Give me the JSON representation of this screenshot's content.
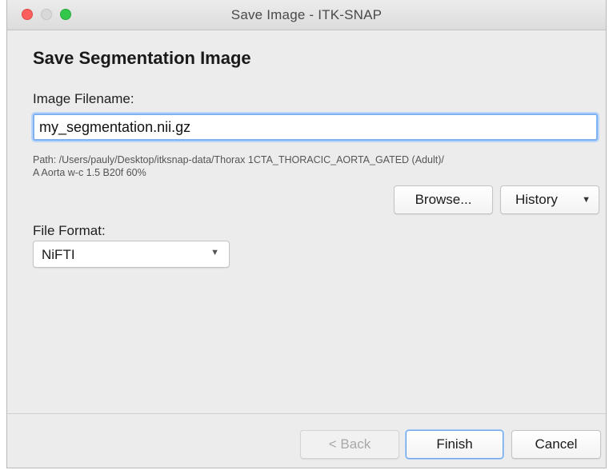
{
  "window": {
    "title": "Save Image - ITK-SNAP"
  },
  "dialog": {
    "heading": "Save Segmentation Image",
    "filename_label": "Image Filename:",
    "filename_value": "my_segmentation.nii.gz",
    "path_line1": "Path: /Users/pauly/Desktop/itksnap-data/Thorax 1CTA_THORACIC_AORTA_GATED (Adult)/",
    "path_line2": "A Aorta w-c  1.5  B20f  60%",
    "browse_label": "Browse...",
    "history_label": "History",
    "format_label": "File Format:",
    "format_value": "NiFTI"
  },
  "footer": {
    "back_label": "< Back",
    "finish_label": "Finish",
    "cancel_label": "Cancel"
  },
  "icons": {
    "dropdown": "chevron-down-icon"
  },
  "colors": {
    "close": "#fc605c",
    "minimize": "#d8d8d8",
    "zoom": "#34c84a",
    "focus": "#7fb1f0"
  }
}
